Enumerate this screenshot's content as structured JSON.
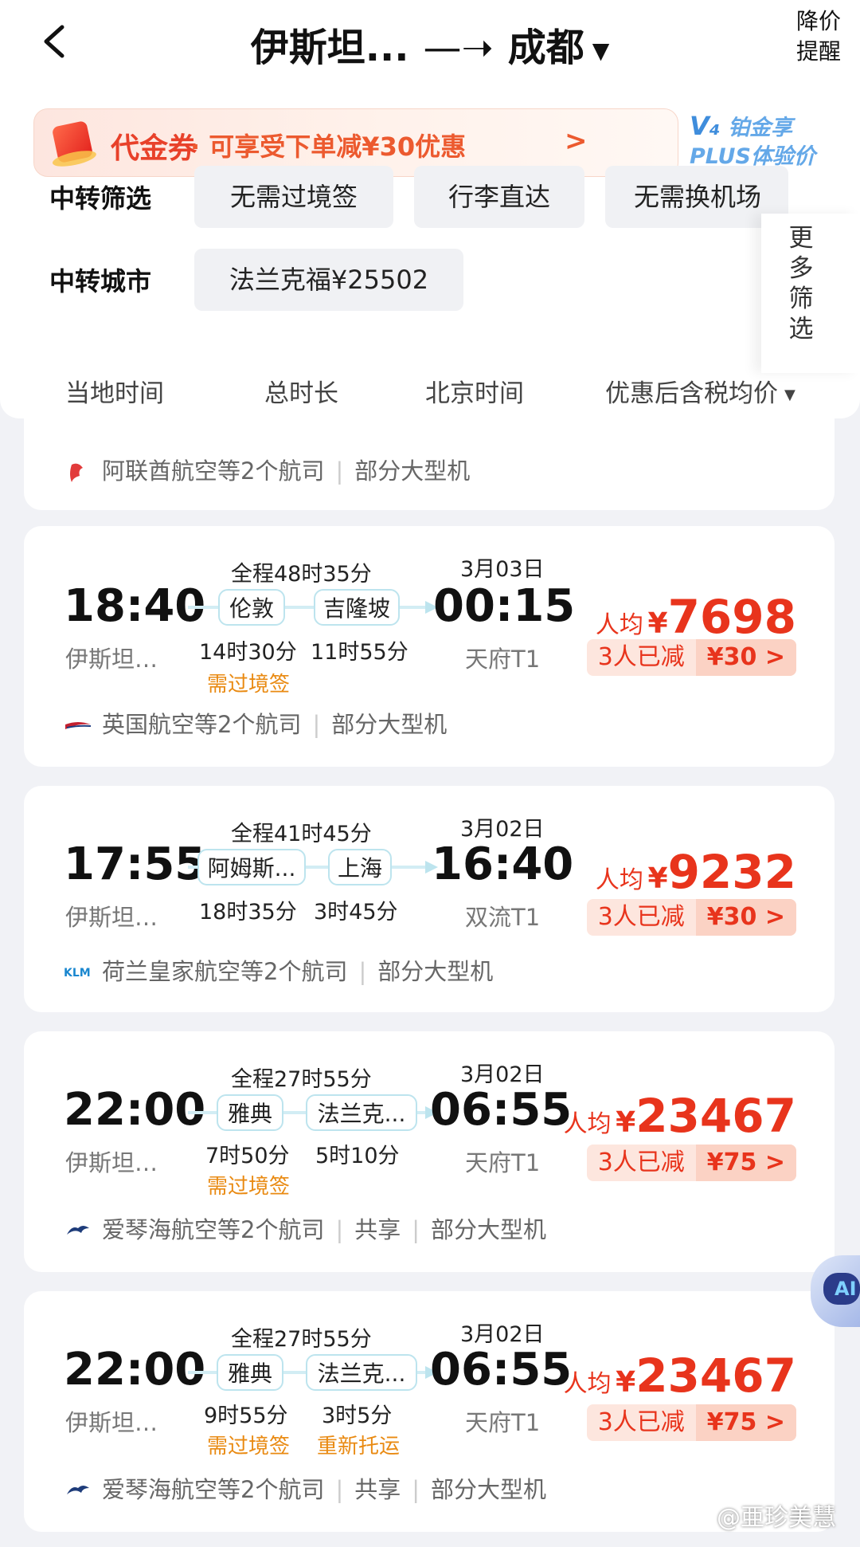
{
  "header": {
    "origin": "伊斯坦...",
    "arrow": "—➝",
    "destination": "成都",
    "price_alert": "降价提醒"
  },
  "coupon": {
    "title": "代金券",
    "desc": "· 可享受下单减¥30优惠",
    "chevron": ">"
  },
  "plus": {
    "badge": "V₄",
    "line1": "铂金享",
    "line2": "PLUS体验价"
  },
  "filters": {
    "transfer_label": "中转筛选",
    "transfer_chips": [
      "无需过境签",
      "行李直达",
      "无需换机场"
    ],
    "city_label": "中转城市",
    "city_chips": [
      "法兰克福¥25502"
    ],
    "more": "更多筛选"
  },
  "sort": [
    "当地时间",
    "总时长",
    "北京时间",
    "优惠后含税均价"
  ],
  "first_card_airline": {
    "name": "阿联酋航空等2个航司",
    "aircraft": "部分大型机"
  },
  "flights": [
    {
      "dep_time": "18:40",
      "dep_airport": "伊斯坦…",
      "total": "全程48时35分",
      "date": "3月03日",
      "arr_time": "00:15",
      "arr_airport": "天府T1",
      "stops": [
        {
          "city": "伦敦",
          "dur": "14时30分",
          "tag": "需过境签"
        },
        {
          "city": "吉隆坡",
          "dur": "11时55分",
          "tag": ""
        }
      ],
      "price_label": "人均",
      "currency": "¥",
      "price": "7698",
      "disc_label": "3人已减",
      "disc_value": "¥30 >",
      "airline": "英国航空等2个航司",
      "share": "",
      "aircraft": "部分大型机",
      "logo": "british-airways-logo"
    },
    {
      "dep_time": "17:55",
      "dep_airport": "伊斯坦…",
      "total": "全程41时45分",
      "date": "3月02日",
      "arr_time": "16:40",
      "arr_airport": "双流T1",
      "stops": [
        {
          "city": "阿姆斯...",
          "dur": "18时35分",
          "tag": ""
        },
        {
          "city": "上海",
          "dur": "3时45分",
          "tag": ""
        }
      ],
      "price_label": "人均",
      "currency": "¥",
      "price": "9232",
      "disc_label": "3人已减",
      "disc_value": "¥30 >",
      "airline": "荷兰皇家航空等2个航司",
      "share": "",
      "aircraft": "部分大型机",
      "logo": "KLM"
    },
    {
      "dep_time": "22:00",
      "dep_airport": "伊斯坦…",
      "total": "全程27时55分",
      "date": "3月02日",
      "arr_time": "06:55",
      "arr_airport": "天府T1",
      "stops": [
        {
          "city": "雅典",
          "dur": "7时50分",
          "tag": "需过境签"
        },
        {
          "city": "法兰克...",
          "dur": "5时10分",
          "tag": ""
        }
      ],
      "price_label": "人均",
      "currency": "¥",
      "price": "23467",
      "disc_label": "3人已减",
      "disc_value": "¥75 >",
      "airline": "爱琴海航空等2个航司",
      "share": "共享",
      "aircraft": "部分大型机",
      "logo": "aegean-logo"
    },
    {
      "dep_time": "22:00",
      "dep_airport": "伊斯坦…",
      "total": "全程27时55分",
      "date": "3月02日",
      "arr_time": "06:55",
      "arr_airport": "天府T1",
      "stops": [
        {
          "city": "雅典",
          "dur": "9时55分",
          "tag": "需过境签"
        },
        {
          "city": "法兰克...",
          "dur": "3时5分",
          "tag": "重新托运"
        }
      ],
      "price_label": "人均",
      "currency": "¥",
      "price": "23467",
      "disc_label": "3人已减",
      "disc_value": "¥75 >",
      "airline": "爱琴海航空等2个航司",
      "share": "共享",
      "aircraft": "部分大型机",
      "logo": "aegean-logo"
    }
  ],
  "assistant": {
    "glyph": "AI"
  },
  "watermark": "@亜珍美慧"
}
